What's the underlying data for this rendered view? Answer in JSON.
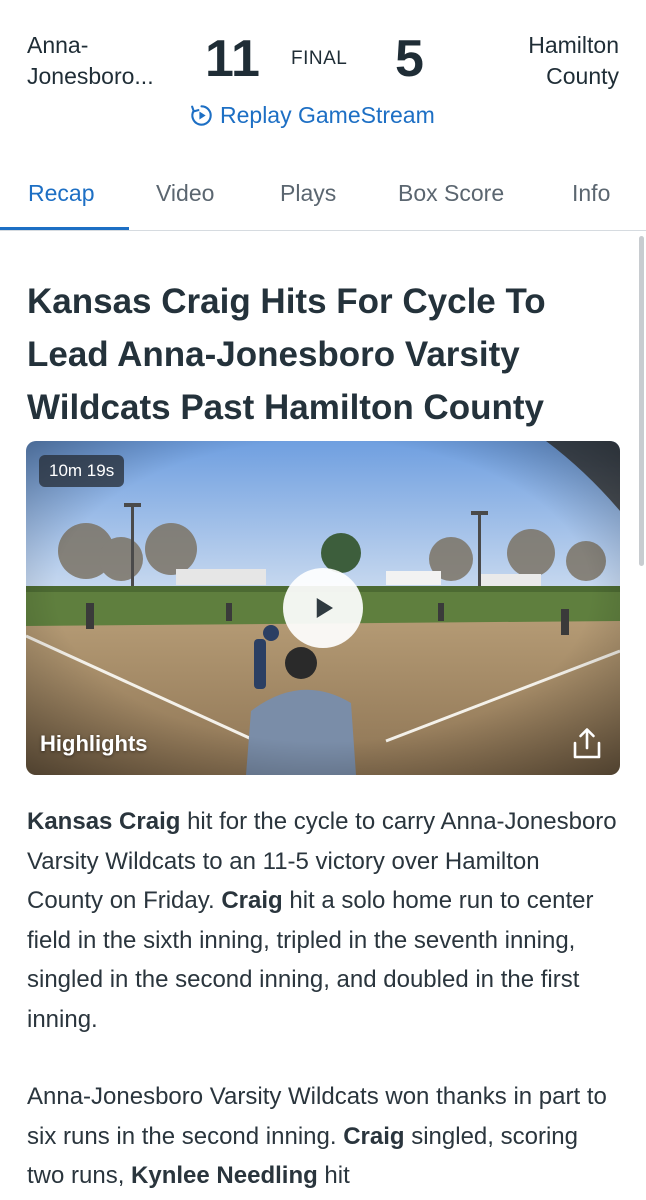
{
  "scoreboard": {
    "home_team": "Anna-Jonesboro...",
    "home_team_line1": "Anna-",
    "home_team_line2": "Jonesboro...",
    "home_score": "11",
    "status": "FINAL",
    "away_score": "5",
    "away_team_line1": "Hamilton",
    "away_team_line2": "County",
    "replay_label": "Replay GameStream"
  },
  "tabs": [
    {
      "label": "Recap",
      "active": true
    },
    {
      "label": "Video",
      "active": false
    },
    {
      "label": "Plays",
      "active": false
    },
    {
      "label": "Box Score",
      "active": false
    },
    {
      "label": "Info",
      "active": false
    }
  ],
  "article": {
    "headline": "Kansas Craig Hits For Cycle To Lead Anna-Jonesboro Varsity Wildcats Past Hamilton County",
    "video": {
      "duration": "10m 19s",
      "label": "Highlights"
    },
    "p1": {
      "a_bold": "Kansas Craig",
      "b": " hit for the cycle to carry Anna-Jonesboro Varsity Wildcats to an 11-5 victory over Hamilton County on Friday. ",
      "c_bold": "Craig",
      "d": " hit a solo home run to center field in the sixth inning, tripled in the seventh inning, singled in the second inning, and doubled in the first inning."
    },
    "p2": {
      "a": "Anna-Jonesboro Varsity Wildcats won thanks in part to six runs in the second inning.  ",
      "b_bold": "Craig",
      "c": " singled, scoring two runs, ",
      "d_bold": "Kynlee Needling",
      "e": " hit"
    }
  },
  "colors": {
    "accent": "#1d6fc4",
    "text": "#1f2d36",
    "muted": "#5b6670"
  }
}
